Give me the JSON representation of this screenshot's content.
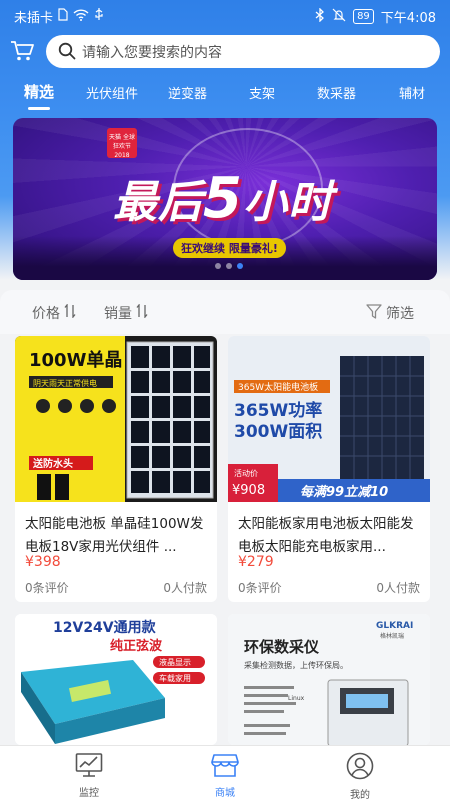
{
  "status_bar": {
    "carrier": "未插卡",
    "battery": "89",
    "time": "下午4:08"
  },
  "search": {
    "placeholder": "请输入您要搜索的内容"
  },
  "tabs": [
    {
      "label": "精选",
      "active": true
    },
    {
      "label": "光伏组件",
      "active": false
    },
    {
      "label": "逆变器",
      "active": false
    },
    {
      "label": "支架",
      "active": false
    },
    {
      "label": "数采器",
      "active": false
    },
    {
      "label": "辅材",
      "active": false
    }
  ],
  "banner": {
    "headline_a": "最后",
    "headline_num": "5",
    "headline_b": "小时",
    "pill": "狂欢继续 限量豪礼!",
    "logo_text": "天猫 全球狂欢节 2018",
    "slide_count": 3,
    "active_slide": 3
  },
  "filters": {
    "price": "价格",
    "sales": "销量",
    "filter": "筛选"
  },
  "products": [
    {
      "title": "太阳能电池板 单晶硅100W发电板18V家用光伏组件 ...",
      "price": "¥398",
      "reviews": "0条评价",
      "paid": "0人付款",
      "img_text_a": "100W单晶",
      "img_text_b": "阴天雨天正常供电",
      "img_text_c": "送防水头"
    },
    {
      "title": "太阳能板家用电池板太阳能发电板太阳能充电板家用...",
      "price": "¥279",
      "reviews": "0条评价",
      "paid": "0人付款",
      "img_text_a": "365W太阳能电池板",
      "img_text_b": "365W功率",
      "img_text_c": "300W面积",
      "img_text_d": "活动价",
      "img_text_e": "¥908",
      "img_text_f": "每满99立减10"
    },
    {
      "title": "",
      "img_text_a": "12V24V通用款",
      "img_text_b": "纯正弦波",
      "img_text_c": "液晶显示",
      "img_text_d": "车载家用"
    },
    {
      "title": "",
      "img_text_a": "GLKRAI",
      "img_text_b": "格林凯瑞",
      "img_text_c": "环保数采仪",
      "img_text_d": "采集检测数据，上传环保局。",
      "img_text_e": "Linux"
    }
  ],
  "bottom_nav": [
    {
      "label": "监控",
      "icon": "monitor-icon",
      "active": false
    },
    {
      "label": "商城",
      "icon": "shop-icon",
      "active": true
    },
    {
      "label": "我的",
      "icon": "user-icon",
      "active": false
    }
  ],
  "colors": {
    "accent": "#3b82f6",
    "price": "#f24b3b",
    "header": "#2f80e8"
  }
}
